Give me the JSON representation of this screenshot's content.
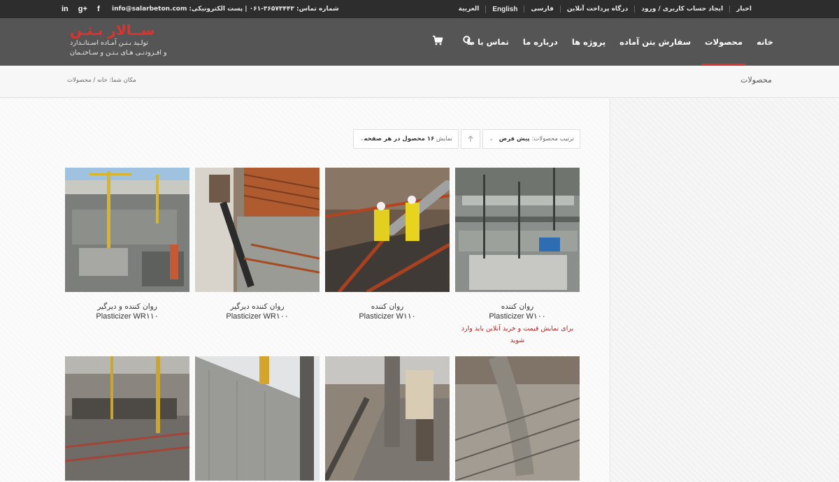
{
  "topbar": {
    "social": [
      "in",
      "g+",
      "f"
    ],
    "email": "info@salarbeton.com",
    "contact_text": "شماره تماس: ۳۶۵۷۳۴۴۳-۰۶۱ | پست الکترونیکی:",
    "links": [
      "اخبار",
      "ایجاد حساب کاربری / ورود",
      "درگاه پرداخت آنلاین",
      "فارسی",
      "English",
      "العربیة"
    ]
  },
  "header": {
    "brand": "ســالار بـتـن",
    "tagline_1": "تولـید بـتـن آمـاده اسـتانـدارد",
    "tagline_2": "و افـزودنـی هـای بـتـن و سـاختـمان",
    "nav": [
      "خانه",
      "محصولات",
      "سفارش بتن آماده",
      "پروژه ها",
      "درباره ما",
      "تماس با ما"
    ],
    "active_nav": "محصولات",
    "icons": [
      "search-icon",
      "cart-icon"
    ],
    "accent": "#e0322f"
  },
  "titlebar": {
    "title": "محصولات",
    "breadcrumb_prefix": "مکان شما:",
    "breadcrumb_home": "خانه",
    "breadcrumb_sep": "/",
    "breadcrumb_current": "محصولات"
  },
  "sorting": {
    "sort_label": "ترتیب محصولات:",
    "sort_value": "پیش فرض",
    "perpage_label": "نمایش",
    "perpage_value": "۱۶ محصول در هر صفحه"
  },
  "products": [
    {
      "name": "روان کننده",
      "model": "Plasticizer W۱۰۰",
      "notice": "برای نمایش قیمت و خرید آنلاین باید وارد شوید"
    },
    {
      "name": "روان کننده",
      "model": "Plasticizer W۱۱۰",
      "notice": ""
    },
    {
      "name": "روان کننده دیرگیر",
      "model": "Plasticizer WR۱۰۰",
      "notice": ""
    },
    {
      "name": "روان کننده و دیرگیر",
      "model": "Plasticizer WR۱۱۰",
      "notice": ""
    }
  ]
}
